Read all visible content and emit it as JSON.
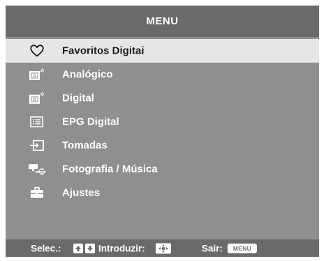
{
  "header": {
    "title": "MENU"
  },
  "menu": {
    "items": [
      {
        "label": "Favoritos Digitai",
        "icon": "heart-icon",
        "selected": true
      },
      {
        "label": "Analógico",
        "icon": "analog-tv-icon",
        "icon_letter": "A",
        "selected": false
      },
      {
        "label": "Digital",
        "icon": "digital-tv-icon",
        "icon_letter": "D",
        "selected": false
      },
      {
        "label": "EPG Digital",
        "icon": "epg-guide-icon",
        "selected": false
      },
      {
        "label": "Tomadas",
        "icon": "input-source-icon",
        "selected": false
      },
      {
        "label": "Fotografia / Música",
        "icon": "usb-media-icon",
        "selected": false
      },
      {
        "label": "Ajustes",
        "icon": "toolbox-icon",
        "selected": false
      }
    ]
  },
  "footer": {
    "select_label": "Selec.:",
    "enter_label": "Introduzir:",
    "exit_label": "Sair:",
    "menu_key": "MENU"
  },
  "colors": {
    "background": "#8f8f8f",
    "bars": "#6a6a6a",
    "highlight": "#e6e6e6",
    "text": "#ffffff"
  }
}
